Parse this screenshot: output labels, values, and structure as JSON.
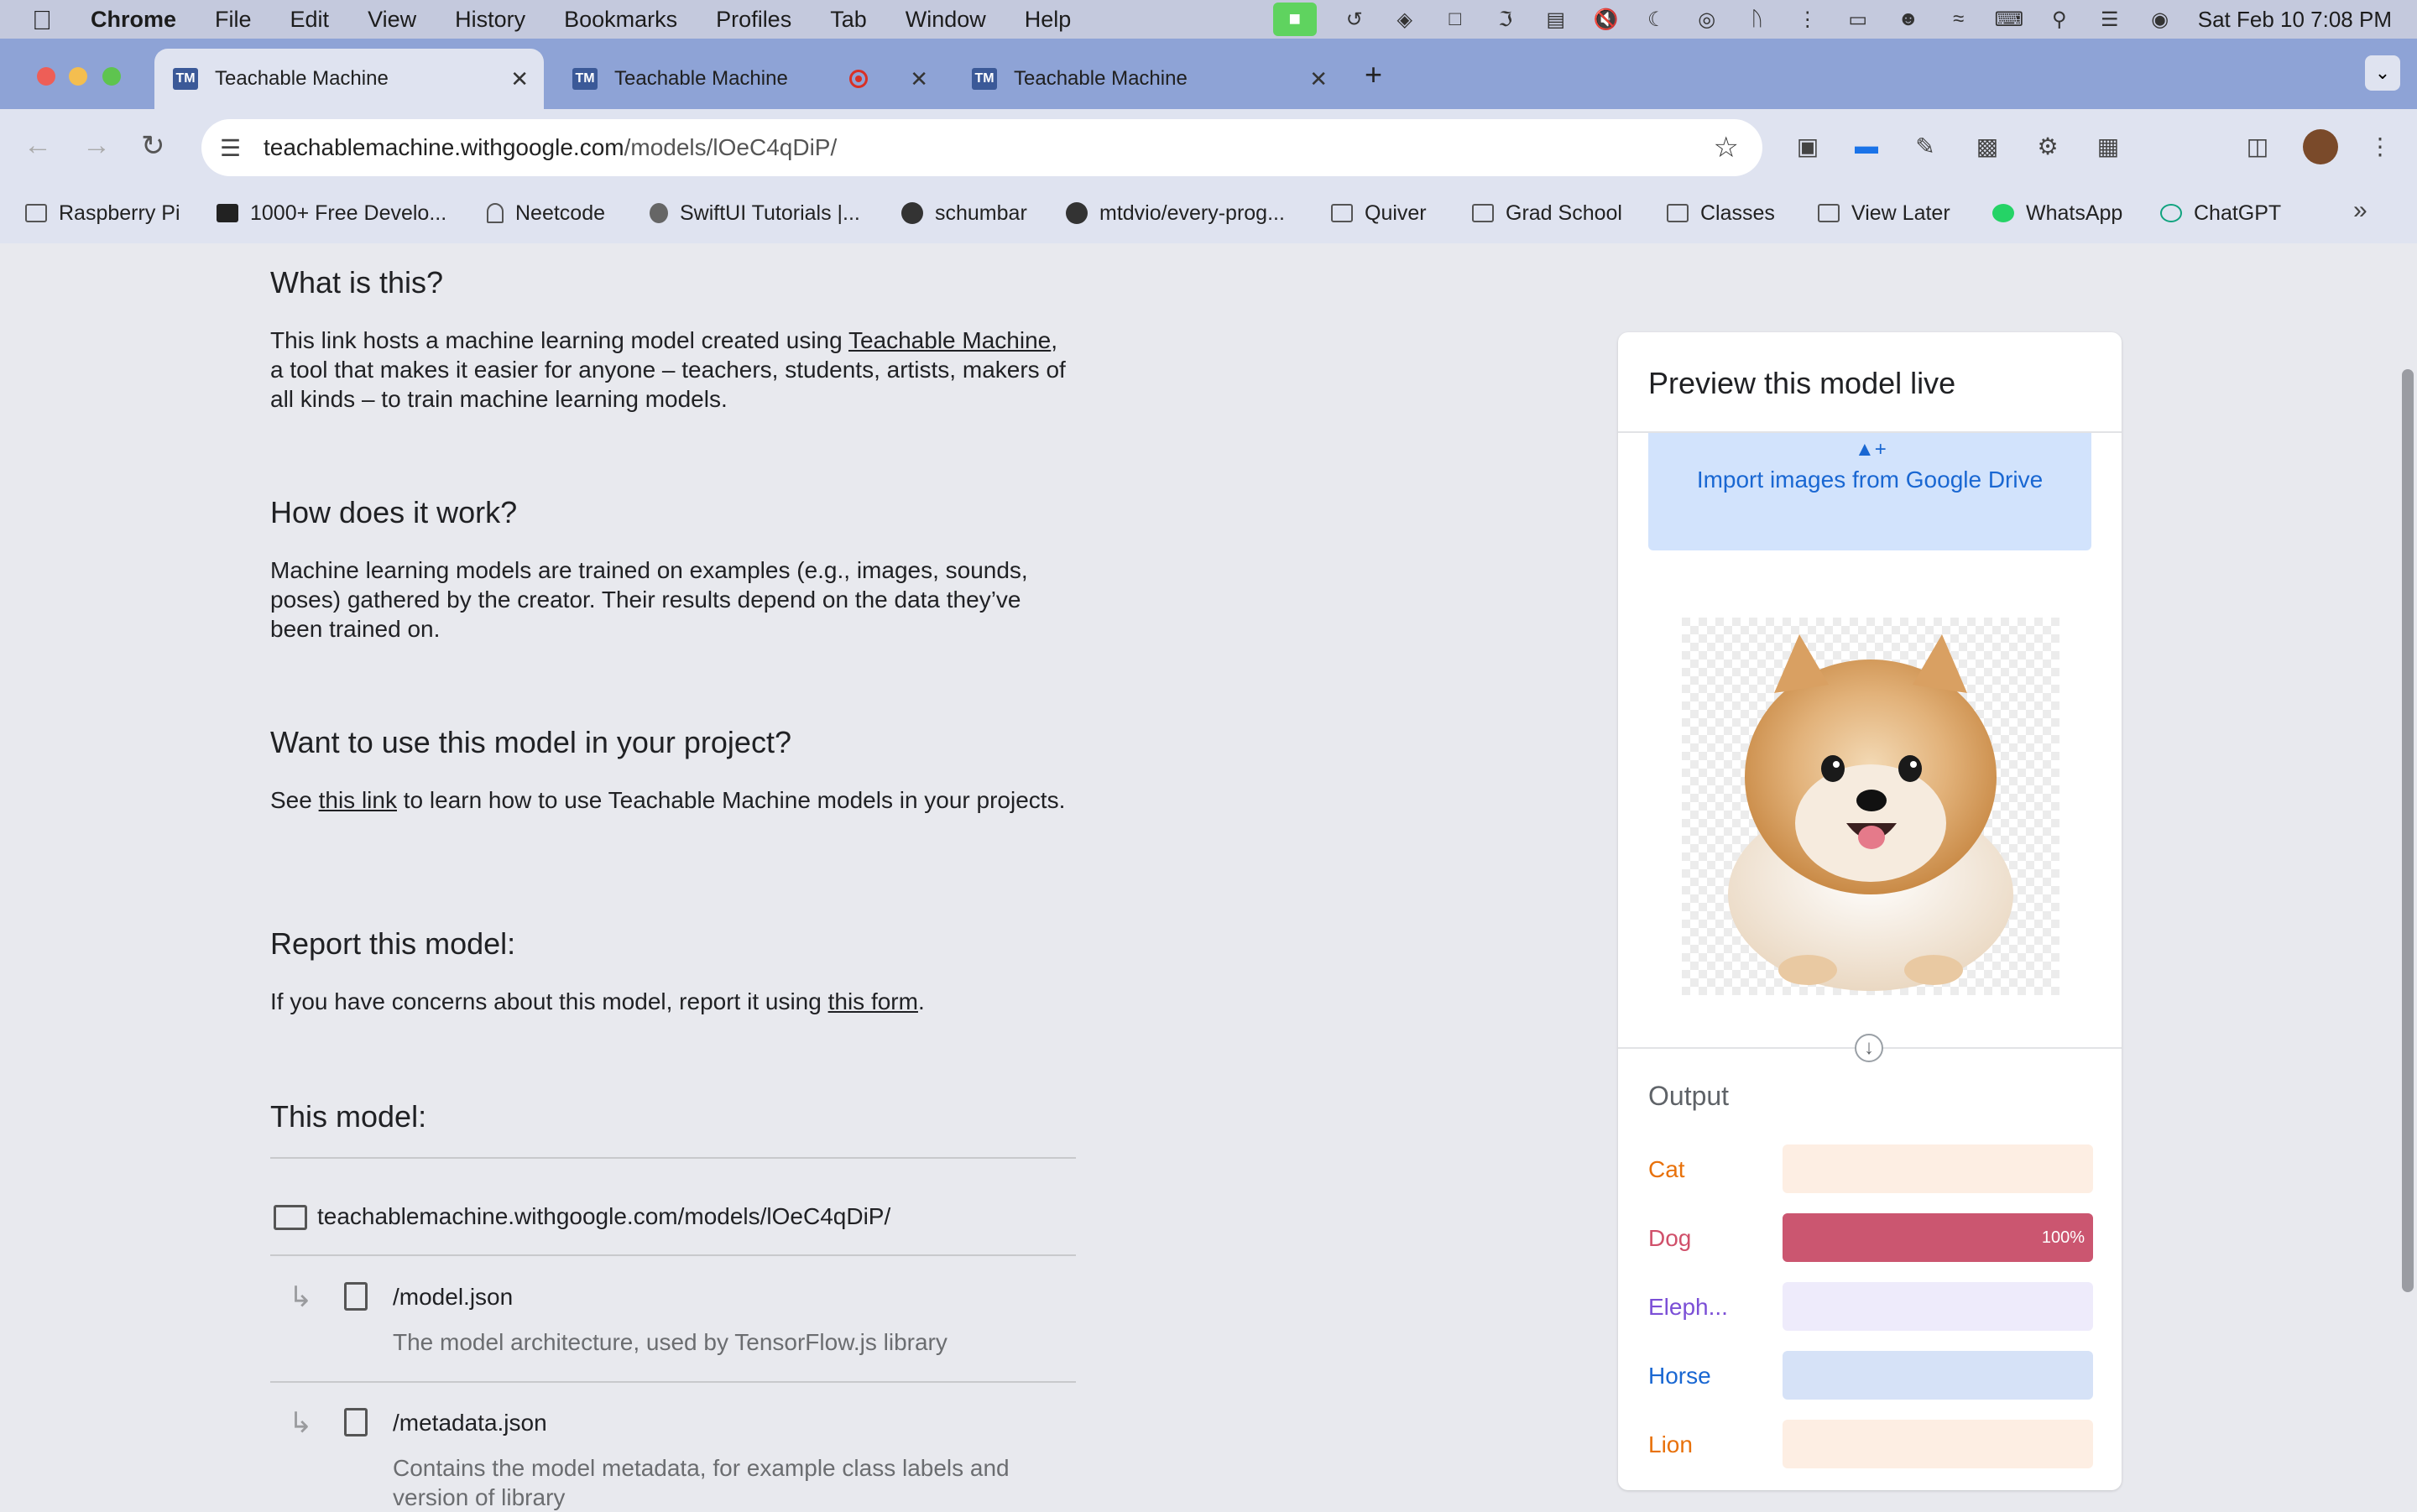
{
  "menubar": {
    "app": "Chrome",
    "items": [
      "File",
      "Edit",
      "View",
      "History",
      "Bookmarks",
      "Profiles",
      "Tab",
      "Window",
      "Help"
    ],
    "datetime": "Sat Feb 10  7:08 PM"
  },
  "tabs": [
    {
      "title": "Teachable Machine",
      "favicon": "TM",
      "active": true
    },
    {
      "title": "Teachable Machine",
      "favicon": "TM",
      "active": false,
      "recording": true
    },
    {
      "title": "Teachable Machine",
      "favicon": "TM",
      "active": false
    }
  ],
  "address": {
    "host": "teachablemachine.withgoogle.com",
    "path": "/models/lOeC4qDiP/"
  },
  "bookmarks": [
    {
      "label": "Raspberry Pi",
      "icon": "folder-icon"
    },
    {
      "label": "1000+ Free Develo...",
      "icon": "codecademy-icon"
    },
    {
      "label": "Neetcode",
      "icon": "bell-icon"
    },
    {
      "label": "SwiftUI Tutorials |...",
      "icon": "apple-icon"
    },
    {
      "label": "schumbar",
      "icon": "github-icon"
    },
    {
      "label": "mtdvio/every-prog...",
      "icon": "github-icon"
    },
    {
      "label": "Quiver",
      "icon": "folder-icon"
    },
    {
      "label": "Grad School",
      "icon": "folder-icon"
    },
    {
      "label": "Classes",
      "icon": "folder-icon"
    },
    {
      "label": "View Later",
      "icon": "folder-icon"
    },
    {
      "label": "WhatsApp",
      "icon": "whatsapp-icon"
    },
    {
      "label": "ChatGPT",
      "icon": "chatgpt-icon"
    }
  ],
  "content": {
    "what_title": "What is this?",
    "what_p1": "This link hosts a machine learning model created using ",
    "what_link": "Teachable Machine",
    "what_p2": ", a tool that makes it easier for anyone – teachers, students, artists, makers of all kinds – to train machine learning models.",
    "how_title": "How does it work?",
    "how_p": "Machine learning models are trained on examples (e.g., images, sounds, poses) gathered by the creator. Their results depend on the data they’ve been trained on.",
    "use_title": "Want to use this model in your project?",
    "use_p1": "See ",
    "use_link": "this link",
    "use_p2": " to learn how to use Teachable Machine models in your projects.",
    "report_title": "Report this model:",
    "report_p1": "If you have concerns about this model, report it using ",
    "report_link": "this form",
    "report_p2": ".",
    "model_title": "This model:",
    "model_url": "teachablemachine.withgoogle.com/models/lOeC4qDiP/",
    "files": [
      {
        "name": "/model.json",
        "desc": "The model architecture, used by TensorFlow.js library"
      },
      {
        "name": "/metadata.json",
        "desc": "Contains the model metadata, for example class labels and version of library"
      }
    ]
  },
  "preview": {
    "title": "Preview this model live",
    "drive_button": "Import images from Google Drive",
    "output_title": "Output",
    "classes": [
      {
        "label": "Cat",
        "value": 0,
        "color": "#e8710a",
        "track": "#fdeee3",
        "fill": "#e8710a"
      },
      {
        "label": "Dog",
        "value": 100,
        "pct_label": "100%",
        "color": "#d0506a",
        "track": "#f7dde3",
        "fill": "#cb5670"
      },
      {
        "label": "Eleph...",
        "value": 0,
        "color": "#7b4fd6",
        "track": "#eeebfb",
        "fill": "#7b4fd6"
      },
      {
        "label": "Horse",
        "value": 0,
        "color": "#1967d2",
        "track": "#d6e2f7",
        "fill": "#1967d2"
      },
      {
        "label": "Lion",
        "value": 0,
        "color": "#e8710a",
        "track": "#fdeee3",
        "fill": "#e8710a"
      }
    ]
  }
}
